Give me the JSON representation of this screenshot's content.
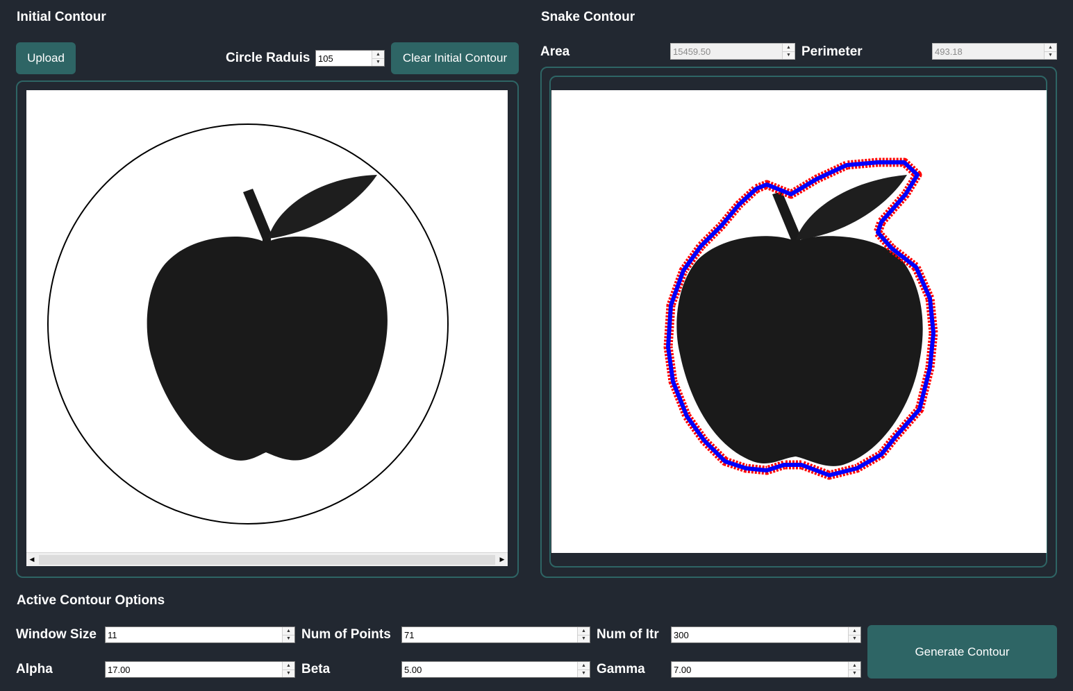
{
  "initial": {
    "heading": "Initial Contour",
    "upload_label": "Upload",
    "radius_label": "Circle Raduis",
    "radius_value": "105",
    "clear_label": "Clear Initial Contour"
  },
  "snake": {
    "heading": "Snake Contour",
    "area_label": "Area",
    "area_value": "15459.50",
    "perimeter_label": "Perimeter",
    "perimeter_value": "493.18"
  },
  "options": {
    "heading": "Active Contour Options",
    "window_size_label": "Window Size",
    "window_size_value": "11",
    "num_points_label": "Num of Points",
    "num_points_value": "71",
    "num_itr_label": "Num of Itr",
    "num_itr_value": "300",
    "alpha_label": "Alpha",
    "alpha_value": "17.00",
    "beta_label": "Beta",
    "beta_value": "5.00",
    "gamma_label": "Gamma",
    "gamma_value": "7.00",
    "generate_label": "Generate Contour"
  },
  "icons": {
    "spin_up": "triangle-up-icon",
    "spin_down": "triangle-down-icon",
    "scroll_left": "triangle-left-icon",
    "scroll_right": "triangle-right-icon"
  },
  "colors": {
    "background": "#222831",
    "accent": "#2e6565",
    "contour_outer": "#ff0000",
    "contour_inner": "#0000ff",
    "apple": "#1a1a1a"
  }
}
